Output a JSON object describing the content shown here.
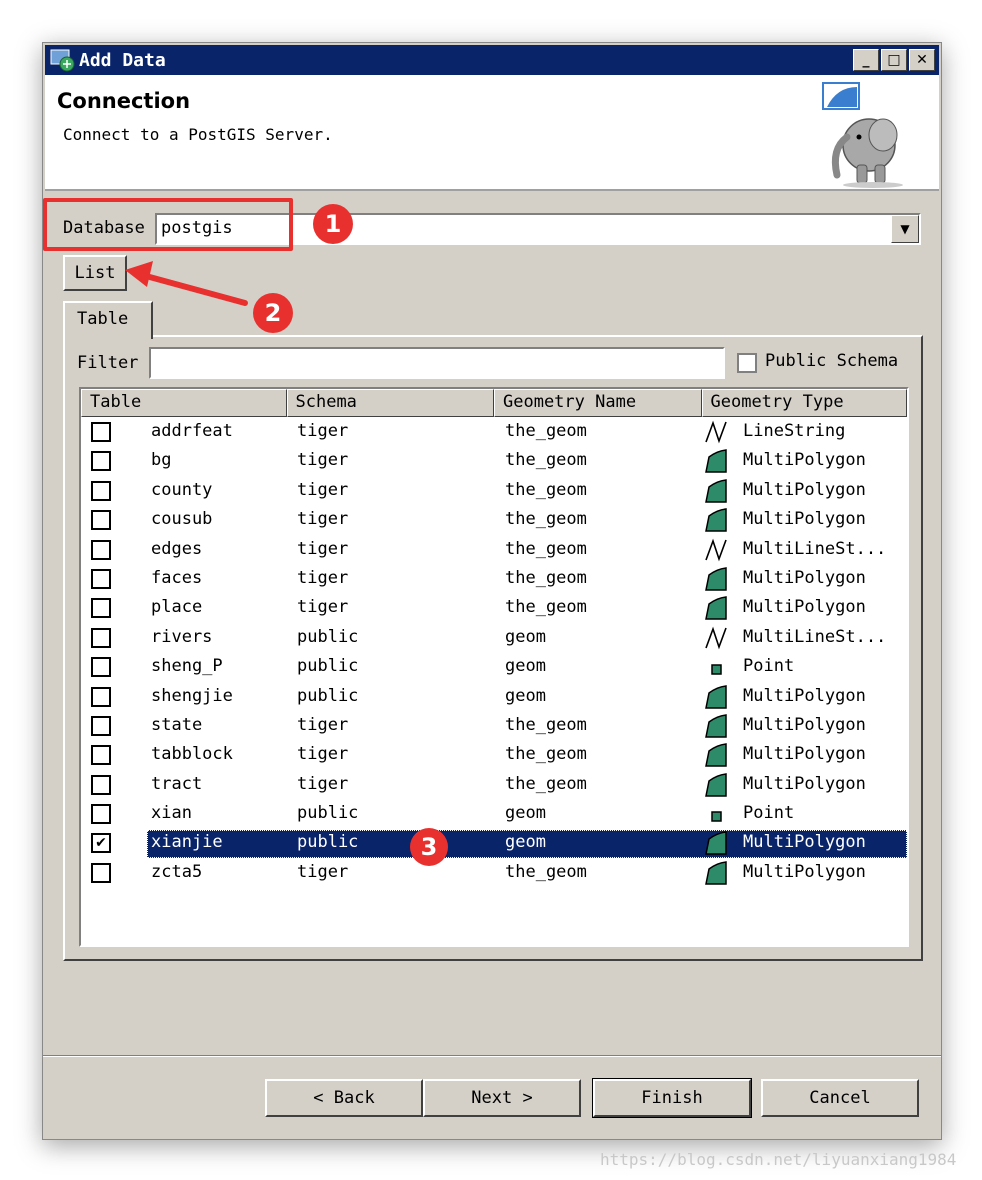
{
  "window": {
    "title": "Add Data",
    "minimize_glyph": "_",
    "maximize_glyph": "□",
    "close_glyph": "✕"
  },
  "header": {
    "title": "Connection",
    "subtitle": "Connect to a PostGIS Server."
  },
  "connection": {
    "database_label": "Database",
    "database_value": "postgis",
    "list_button": "List"
  },
  "tabs": [
    {
      "label": "Table"
    }
  ],
  "filter": {
    "label": "Filter",
    "value": "",
    "public_schema_label": "Public Schema",
    "public_schema_checked": false
  },
  "table": {
    "columns": [
      "Table",
      "Schema",
      "Geometry Name",
      "Geometry Type"
    ],
    "rows": [
      {
        "checked": false,
        "table": "addrfeat",
        "schema": "tiger",
        "geometry_name": "the_geom",
        "geometry_type": "LineString",
        "icon": "line-icon"
      },
      {
        "checked": false,
        "table": "bg",
        "schema": "tiger",
        "geometry_name": "the_geom",
        "geometry_type": "MultiPolygon",
        "icon": "polygon-icon"
      },
      {
        "checked": false,
        "table": "county",
        "schema": "tiger",
        "geometry_name": "the_geom",
        "geometry_type": "MultiPolygon",
        "icon": "polygon-icon"
      },
      {
        "checked": false,
        "table": "cousub",
        "schema": "tiger",
        "geometry_name": "the_geom",
        "geometry_type": "MultiPolygon",
        "icon": "polygon-icon"
      },
      {
        "checked": false,
        "table": "edges",
        "schema": "tiger",
        "geometry_name": "the_geom",
        "geometry_type": "MultiLineSt...",
        "icon": "line-icon"
      },
      {
        "checked": false,
        "table": "faces",
        "schema": "tiger",
        "geometry_name": "the_geom",
        "geometry_type": "MultiPolygon",
        "icon": "polygon-icon"
      },
      {
        "checked": false,
        "table": "place",
        "schema": "tiger",
        "geometry_name": "the_geom",
        "geometry_type": "MultiPolygon",
        "icon": "polygon-icon"
      },
      {
        "checked": false,
        "table": "rivers",
        "schema": "public",
        "geometry_name": "geom",
        "geometry_type": "MultiLineSt...",
        "icon": "line-icon"
      },
      {
        "checked": false,
        "table": "sheng_P",
        "schema": "public",
        "geometry_name": "geom",
        "geometry_type": "Point",
        "icon": "point-icon"
      },
      {
        "checked": false,
        "table": "shengjie",
        "schema": "public",
        "geometry_name": "geom",
        "geometry_type": "MultiPolygon",
        "icon": "polygon-icon"
      },
      {
        "checked": false,
        "table": "state",
        "schema": "tiger",
        "geometry_name": "the_geom",
        "geometry_type": "MultiPolygon",
        "icon": "polygon-icon"
      },
      {
        "checked": false,
        "table": "tabblock",
        "schema": "tiger",
        "geometry_name": "the_geom",
        "geometry_type": "MultiPolygon",
        "icon": "polygon-icon"
      },
      {
        "checked": false,
        "table": "tract",
        "schema": "tiger",
        "geometry_name": "the_geom",
        "geometry_type": "MultiPolygon",
        "icon": "polygon-icon"
      },
      {
        "checked": false,
        "table": "xian",
        "schema": "public",
        "geometry_name": "geom",
        "geometry_type": "Point",
        "icon": "point-icon"
      },
      {
        "checked": true,
        "selected": true,
        "table": "xianjie",
        "schema": "public",
        "geometry_name": "geom",
        "geometry_type": "MultiPolygon",
        "icon": "polygon-icon"
      },
      {
        "checked": false,
        "table": "zcta5",
        "schema": "tiger",
        "geometry_name": "the_geom",
        "geometry_type": "MultiPolygon",
        "icon": "polygon-icon"
      }
    ]
  },
  "buttons": {
    "back": "< Back",
    "next": "Next >",
    "finish": "Finish",
    "cancel": "Cancel"
  },
  "annotations": [
    "1",
    "2",
    "3"
  ],
  "watermark": "https://blog.csdn.net/liyuanxiang1984",
  "colors": {
    "titlebar": "#0a246a",
    "selection": "#0a246a",
    "marker": "#e8312f",
    "polygon_fill": "#2e8b6a"
  }
}
